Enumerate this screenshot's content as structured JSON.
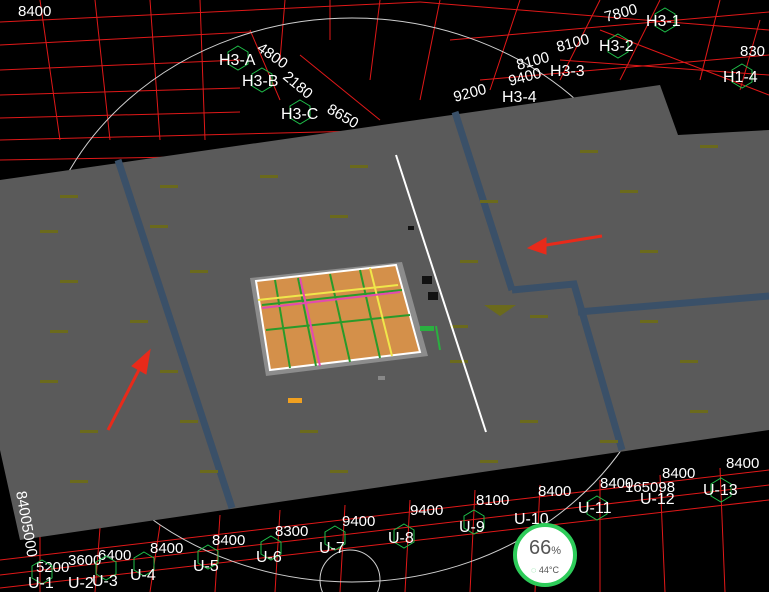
{
  "top_labels": {
    "dim_8400_top": "8400",
    "dim_7800": "7800",
    "dim_4800": "4800",
    "dim_8100_a": "8100",
    "dim_8100_b": "8100",
    "dim_9200": "9200",
    "dim_9400_top": "9400",
    "dim_8650": "8650",
    "dim_830": "830",
    "dim_2180": "2180"
  },
  "top_axes": {
    "h3_1": "H3-1",
    "h3_2": "H3-2",
    "h3_3": "H3-3",
    "h3_4": "H3-4",
    "h3_a": "H3-A",
    "h3_b": "H3-B",
    "h3_c": "H3-C",
    "h1_4": "H1-4"
  },
  "bottom_dims": {
    "d1": "5200",
    "d2": "3600",
    "d3": "6400",
    "d4": "8400",
    "d5": "8400",
    "d6": "8300",
    "d7": "9400",
    "d8": "9400",
    "d9": "8100",
    "d10": "8400",
    "d11": "8400",
    "d12": "8400",
    "d13": "8400",
    "d14": "165098",
    "d_left": "84005000"
  },
  "bottom_axes": {
    "u1": "U-1",
    "u2": "U-2",
    "u3": "U-3",
    "u4": "U-4",
    "u5": "U-5",
    "u6": "U-6",
    "u7": "U-7",
    "u8": "U-8",
    "u9": "U-9",
    "u10": "U-10",
    "u11": "U-11",
    "u12": "U-12",
    "u13": "U-13"
  },
  "status": {
    "percent": "66",
    "percent_unit": "%",
    "temperature": "44°C"
  },
  "colors": {
    "slab": "#5a5a5a",
    "grid_line": "#e01818",
    "beam": "#3a5068",
    "opening_fill": "#d4904a",
    "arrow": "#e82a1a",
    "status_ring": "#2ecc5a"
  }
}
